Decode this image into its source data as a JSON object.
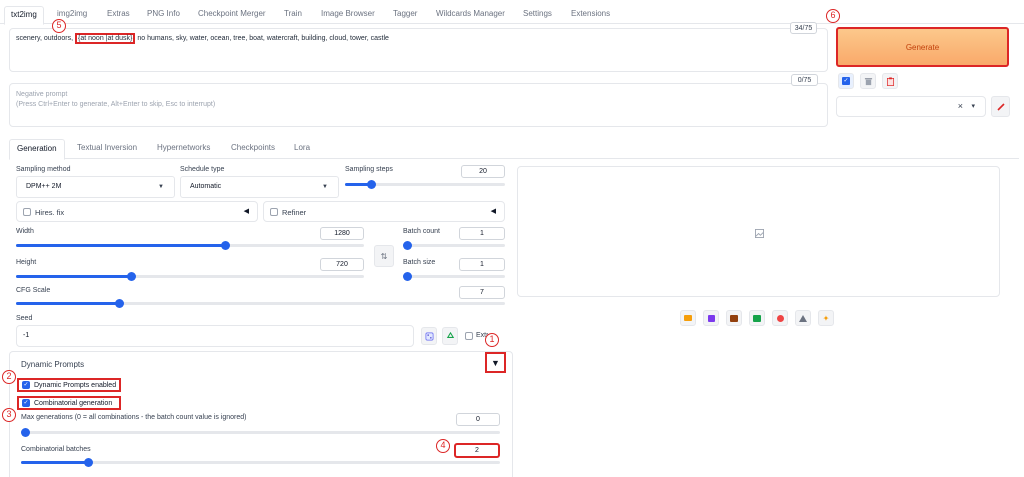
{
  "top_tabs": [
    {
      "label": "txt2img"
    },
    {
      "label": "img2img"
    },
    {
      "label": "Extras"
    },
    {
      "label": "PNG Info"
    },
    {
      "label": "Checkpoint Merger"
    },
    {
      "label": "Train"
    },
    {
      "label": "Image Browser"
    },
    {
      "label": "Tagger"
    },
    {
      "label": "Wildcards Manager"
    },
    {
      "label": "Settings"
    },
    {
      "label": "Extensions"
    }
  ],
  "prompt": {
    "before": "scenery, outdoors, ",
    "highlight": "{at noon |at dusk}",
    "after": " no humans, sky, water, ocean, tree, boat, watercraft, building, cloud, tower, castle",
    "counter": "34/75"
  },
  "negative_prompt": {
    "placeholder_line1": "Negative prompt",
    "placeholder_line2": "(Press Ctrl+Enter to generate, Alt+Enter to skip, Esc to interrupt)",
    "counter": "0/75"
  },
  "generate": {
    "label": "Generate"
  },
  "style_select": {
    "clear": "×",
    "caret": "▾"
  },
  "sub_tabs": [
    {
      "label": "Generation"
    },
    {
      "label": "Textual Inversion"
    },
    {
      "label": "Hypernetworks"
    },
    {
      "label": "Checkpoints"
    },
    {
      "label": "Lora"
    }
  ],
  "sampling_method": {
    "label": "Sampling method",
    "value": "DPM++ 2M"
  },
  "schedule_type": {
    "label": "Schedule type",
    "value": "Automatic"
  },
  "sampling_steps": {
    "label": "Sampling steps",
    "value": "20",
    "fraction": 0.16
  },
  "hires_fix": {
    "label": "Hires. fix",
    "caret": "◀"
  },
  "refiner": {
    "label": "Refiner",
    "caret": "◀"
  },
  "width": {
    "label": "Width",
    "value": "1280",
    "fraction": 0.6
  },
  "height": {
    "label": "Height",
    "value": "720",
    "fraction": 0.33
  },
  "swap_icon": "⇅",
  "batch_count": {
    "label": "Batch count",
    "value": "1",
    "fraction": 0.0
  },
  "batch_size": {
    "label": "Batch size",
    "value": "1",
    "fraction": 0.0
  },
  "cfg_scale": {
    "label": "CFG Scale",
    "value": "7",
    "fraction": 0.21
  },
  "seed": {
    "label": "Seed",
    "value": "-1",
    "extra_label": "Extra"
  },
  "dynamic_prompts": {
    "title": "Dynamic Prompts",
    "toggle": "▼",
    "enabled_label": "Dynamic Prompts enabled",
    "combinatorial_label": "Combinatorial generation",
    "max_generations_label": "Max generations (0 = all combinations - the batch count value is ignored)",
    "max_generations_value": "0",
    "max_generations_fraction": 0.0,
    "combinatorial_batches_label": "Combinatorial batches",
    "combinatorial_batches_value": "2",
    "combinatorial_batches_fraction": 0.14
  },
  "markers": [
    "1",
    "2",
    "3",
    "4",
    "5",
    "6"
  ],
  "colors": {
    "accent": "#2563eb",
    "annotation": "#dc2626",
    "generate": "#f9a96a"
  }
}
